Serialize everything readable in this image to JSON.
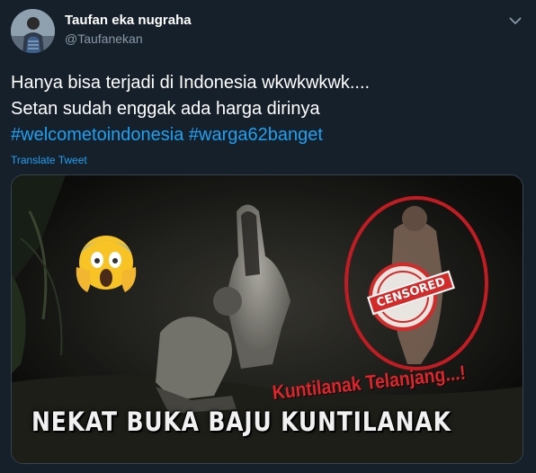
{
  "tweet": {
    "author": {
      "name": "Taufan eka nugraha",
      "handle": "@Taufanekan",
      "avatar_icon": "profile-photo"
    },
    "more_icon": "chevron-down-icon",
    "text": {
      "line1": "Hanya bisa terjadi di Indonesia wkwkwkwk....",
      "line2": "Setan sudah enggak ada harga dirinya",
      "hashtags": [
        "#welcometoindonesia",
        "#warga62banget"
      ]
    },
    "translate_label": "Translate Tweet",
    "media": {
      "caption": "NEKAT BUKA BAJU KUNTILANAK",
      "subcaption": "Kuntilanak Telanjang...!",
      "stamp_label": "CENSORED",
      "emoji_icon": "screaming-face-emoji"
    }
  },
  "colors": {
    "background": "#15202b",
    "link": "#1da1f2",
    "secondary_text": "#8899a6",
    "border": "#38444d",
    "accent_red": "#e0242b"
  }
}
